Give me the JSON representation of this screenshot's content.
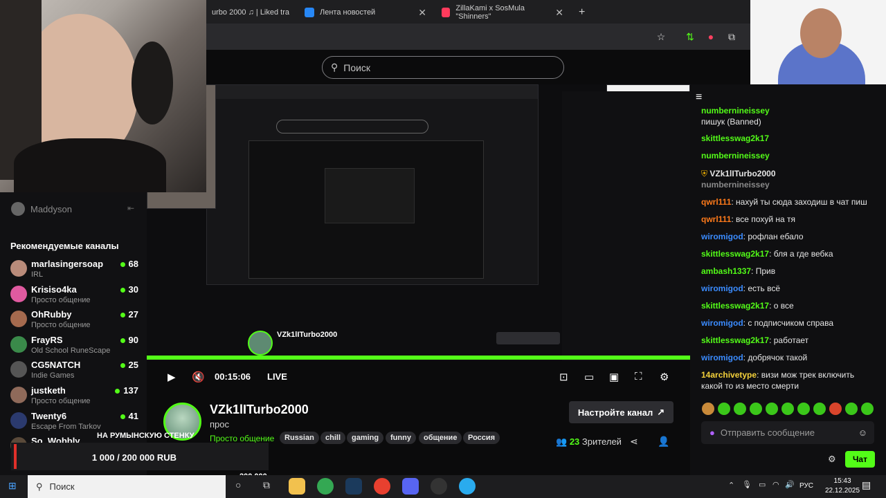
{
  "browser": {
    "tabs": [
      {
        "label": "urbo 2000 ♫ | Liked tra",
        "fav_color": "#1db954"
      },
      {
        "label": "Лента новостей",
        "fav_color": "#2787f5"
      },
      {
        "label": "ZillaKami x SosMula \"Shinners\"",
        "fav_color": "#ff3b5c"
      }
    ],
    "new_tab": "+"
  },
  "search": {
    "placeholder": "Поиск"
  },
  "sidebar": {
    "username": "Maddyson",
    "title": "Рекомендуемые каналы",
    "channels": [
      {
        "name": "marlasingersoap",
        "category": "IRL",
        "viewers": "68",
        "color": "#b98b7a"
      },
      {
        "name": "Krisiso4ka",
        "category": "Просто общение",
        "viewers": "30",
        "color": "#e05aa0"
      },
      {
        "name": "OhRubby",
        "category": "Просто общение",
        "viewers": "27",
        "color": "#a56a4e"
      },
      {
        "name": "FrayRS",
        "category": "Old School RuneScape",
        "viewers": "90",
        "color": "#3a8a4a"
      },
      {
        "name": "CG5NATCH",
        "category": "Indie Games",
        "viewers": "25",
        "color": "#555"
      },
      {
        "name": "justketh",
        "category": "Просто общение",
        "viewers": "137",
        "color": "#8f6a5a"
      },
      {
        "name": "Twenty6",
        "category": "Escape From Tarkov",
        "viewers": "41",
        "color": "#2b3a6e"
      },
      {
        "name": "So_Wobbly",
        "category": "",
        "viewers": "",
        "color": "#5a4a3a"
      }
    ]
  },
  "player": {
    "time": "00:15:06",
    "live": "LIVE",
    "donation_label": "НА РУМЫНСКУЮ СТЕНКУ",
    "donation_progress": "1 000 / 200 000 RUB",
    "donation_goal": "200 000"
  },
  "channel": {
    "name": "VZk1lITurbo2000",
    "title": "прос",
    "category": "Просто общение",
    "tags": [
      "Russian",
      "chill",
      "gaming",
      "funny",
      "общение",
      "Россия"
    ],
    "setup_button": "Настройте канал",
    "viewers_count": "23",
    "viewers_label": "Зрителей"
  },
  "chat": {
    "messages": [
      {
        "user": "numbernineissey",
        "text": "",
        "color": "#53fc18"
      },
      {
        "user": "",
        "text": "пишук (Banned)",
        "color": "#e6e6e6"
      },
      {
        "user": "skittlesswag2k17",
        "text": "",
        "color": "#53fc18"
      },
      {
        "user": "numbernineissey",
        "text": "",
        "color": "#53fc18"
      },
      {
        "user": "VZk1lITurbo2000",
        "text": "",
        "color": "#e6e6e6"
      },
      {
        "user": "numbernineissey",
        "text": "",
        "color": "#8a8a8a"
      },
      {
        "user": "qwrl111",
        "text": ": нахуй ты сюда заходиш в чат пиш",
        "color": "#ff7a1a"
      },
      {
        "user": "qwrl111",
        "text": ": все похуй на тя",
        "color": "#ff7a1a"
      },
      {
        "user": "wiromigod",
        "text": ": рофлан ебало",
        "color": "#3b8cff"
      },
      {
        "user": "skittlesswag2k17",
        "text": ": бля а где вебка",
        "color": "#53fc18"
      },
      {
        "user": "ambash1337",
        "text": ": Прив",
        "color": "#53fc18"
      },
      {
        "user": "wiromigod",
        "text": ": есть всё",
        "color": "#3b8cff"
      },
      {
        "user": "skittlesswag2k17",
        "text": ": о все",
        "color": "#53fc18"
      },
      {
        "user": "wiromigod",
        "text": ": с подписчиком справа",
        "color": "#3b8cff"
      },
      {
        "user": "skittlesswag2k17",
        "text": ": работает",
        "color": "#53fc18"
      },
      {
        "user": "wiromigod",
        "text": ": добрячок такой",
        "color": "#3b8cff"
      },
      {
        "user": "14archivetype",
        "text": ": визи мож трек включить какой то из место смерти",
        "color": "#f5d23b"
      }
    ],
    "input_placeholder": "Отправить сообщение",
    "send_button": "Чат"
  },
  "taskbar": {
    "search": "Поиск",
    "lang": "РУС",
    "time": "15:43",
    "date": "22.12.2025"
  }
}
